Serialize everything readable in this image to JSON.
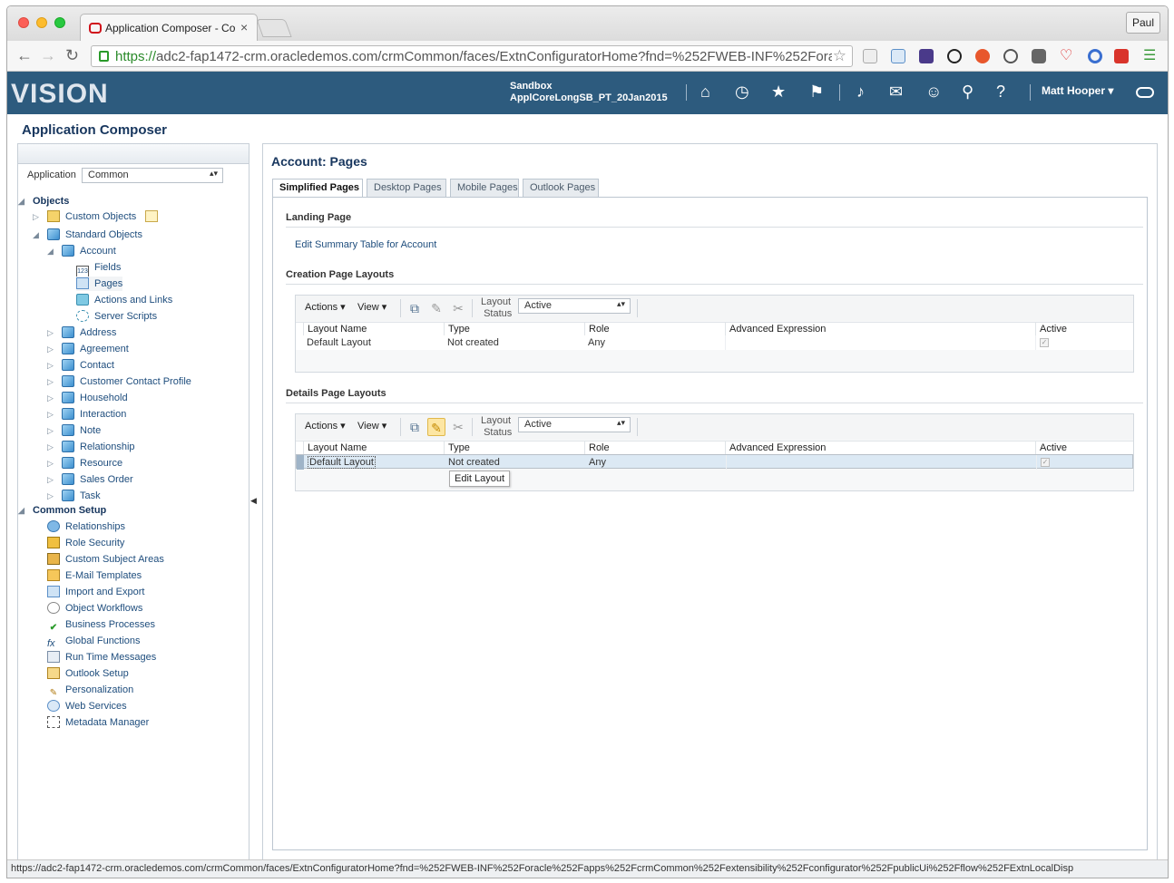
{
  "browser": {
    "tab_title": "Application Composer - Co",
    "user": "Paul",
    "url_scheme": "https://",
    "url_rest": "adc2-fap1472-crm.oracledemos.com/crmCommon/faces/ExtnConfiguratorHome?fnd=%252FWEB-INF%252Fora…",
    "status_url": "https://adc2-fap1472-crm.oracledemos.com/crmCommon/faces/ExtnConfiguratorHome?fnd=%252FWEB-INF%252Foracle%252Fapps%252FcrmCommon%252Fextensibility%252Fconfigurator%252FpublicUi%252Fflow%252FExtnLocalDisp"
  },
  "header": {
    "logo": "VISION",
    "sandbox_label": "Sandbox",
    "sandbox_name": "ApplCoreLongSB_PT_20Jan2015",
    "user": "Matt Hooper ▾"
  },
  "left": {
    "title": "Application Composer",
    "application_label": "Application",
    "application_value": "Common",
    "objects_label": "Objects",
    "custom_objects": "Custom Objects",
    "standard_objects": "Standard Objects",
    "account": "Account",
    "account_children": [
      "Fields",
      "Pages",
      "Actions and Links",
      "Server Scripts"
    ],
    "standard_list": [
      "Address",
      "Agreement",
      "Contact",
      "Customer Contact Profile",
      "Household",
      "Interaction",
      "Note",
      "Relationship",
      "Resource",
      "Sales Order",
      "Task"
    ],
    "common_setup": "Common Setup",
    "setup_list": [
      "Relationships",
      "Role Security",
      "Custom Subject Areas",
      "E-Mail Templates",
      "Import and Export",
      "Object Workflows",
      "Business Processes",
      "Global Functions",
      "Run Time Messages",
      "Outlook Setup",
      "Personalization",
      "Web Services",
      "Metadata Manager"
    ]
  },
  "main": {
    "title": "Account: Pages",
    "tabs": [
      "Simplified Pages",
      "Desktop Pages",
      "Mobile Pages",
      "Outlook Pages"
    ],
    "landing_heading": "Landing Page",
    "landing_link": "Edit Summary Table for Account",
    "creation_heading": "Creation Page Layouts",
    "details_heading": "Details Page Layouts",
    "toolbar": {
      "actions": "Actions ▾",
      "view": "View ▾",
      "layout_status_1": "Layout",
      "layout_status_2": "Status",
      "status_value": "Active"
    },
    "columns": [
      "Layout Name",
      "Type",
      "Role",
      "Advanced Expression",
      "Active"
    ],
    "creation_row": [
      "Default Layout",
      "Not created",
      "Any",
      ""
    ],
    "details_row": [
      "Default Layout",
      "Not created",
      "Any",
      ""
    ],
    "tooltip": "Edit Layout"
  },
  "colors": {
    "header_bg": "#2d5b7e",
    "title_text": "#17365e",
    "link": "#1e4d7d"
  }
}
